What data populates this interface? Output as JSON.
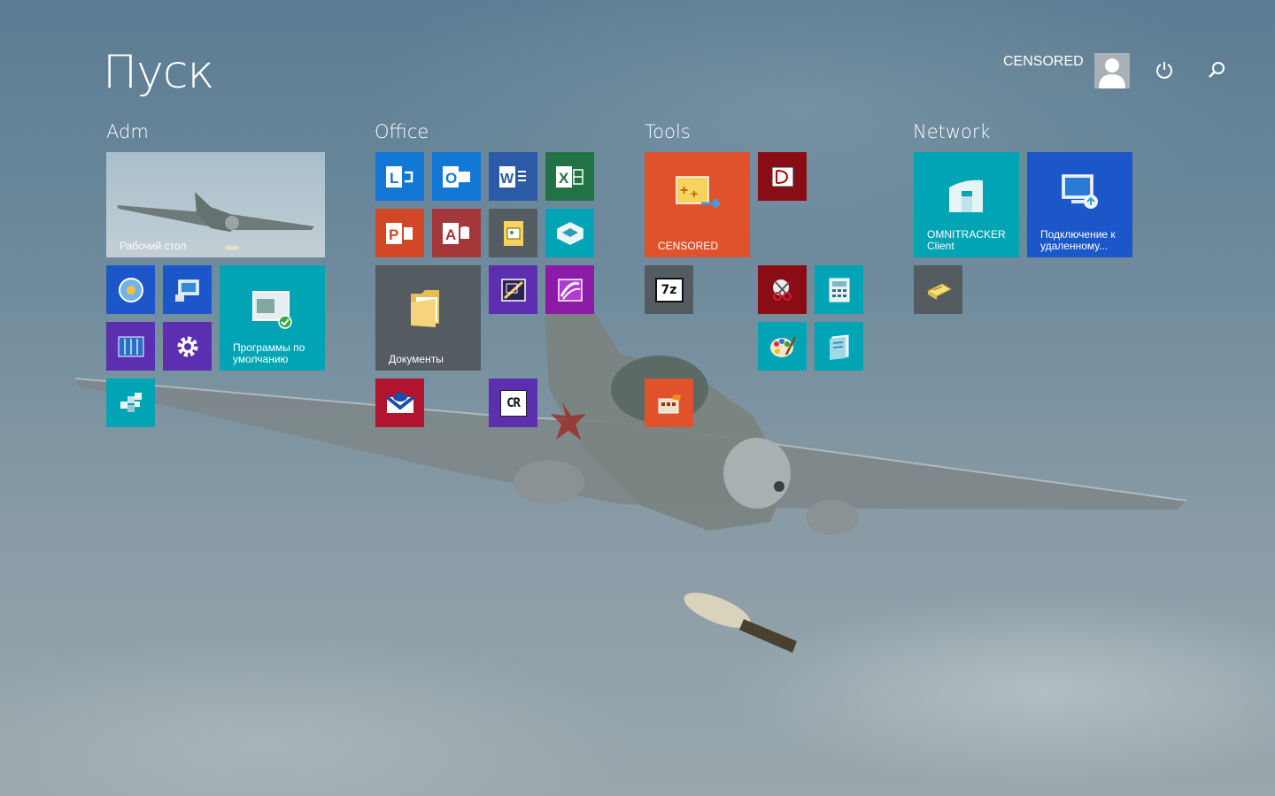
{
  "header": {
    "title": "Пуск",
    "user_name": "CENSORED"
  },
  "groups": [
    {
      "name": "Adm"
    },
    {
      "name": "Office"
    },
    {
      "name": "Tools"
    },
    {
      "name": "Network"
    }
  ],
  "tiles": {
    "desktop": {
      "label": "Рабочий стол"
    },
    "default_programs": {
      "label": "Программы по умолчанию"
    },
    "documents": {
      "label": "Документы"
    },
    "censored_app": {
      "label": "CENSORED"
    },
    "omnitracker": {
      "label": "OMNITRACKER Client"
    },
    "remote_desktop": {
      "label": "Подключение к удаленному..."
    },
    "sevenzip": {
      "label": "7z"
    },
    "crystal": {
      "label": "CR"
    }
  },
  "icons": {
    "lync": "lync-icon",
    "outlook": "outlook-icon",
    "word": "word-icon",
    "excel": "excel-icon",
    "powerpoint": "powerpoint-icon",
    "access": "access-icon",
    "publisher": "publisher-icon",
    "infopath": "infopath-icon"
  },
  "colors": {
    "blue_tile": "#1b57c9",
    "purple_tile": "#5b2fb0",
    "teal_tile": "#00a4b4",
    "dark_red_tile": "#8a0d15",
    "orange_tile": "#e0522b",
    "gray_tile": "#555c61",
    "word_blue": "#2b5aa6",
    "excel_green": "#217346",
    "ppt_orange": "#d24726",
    "access_red": "#a4373a"
  }
}
